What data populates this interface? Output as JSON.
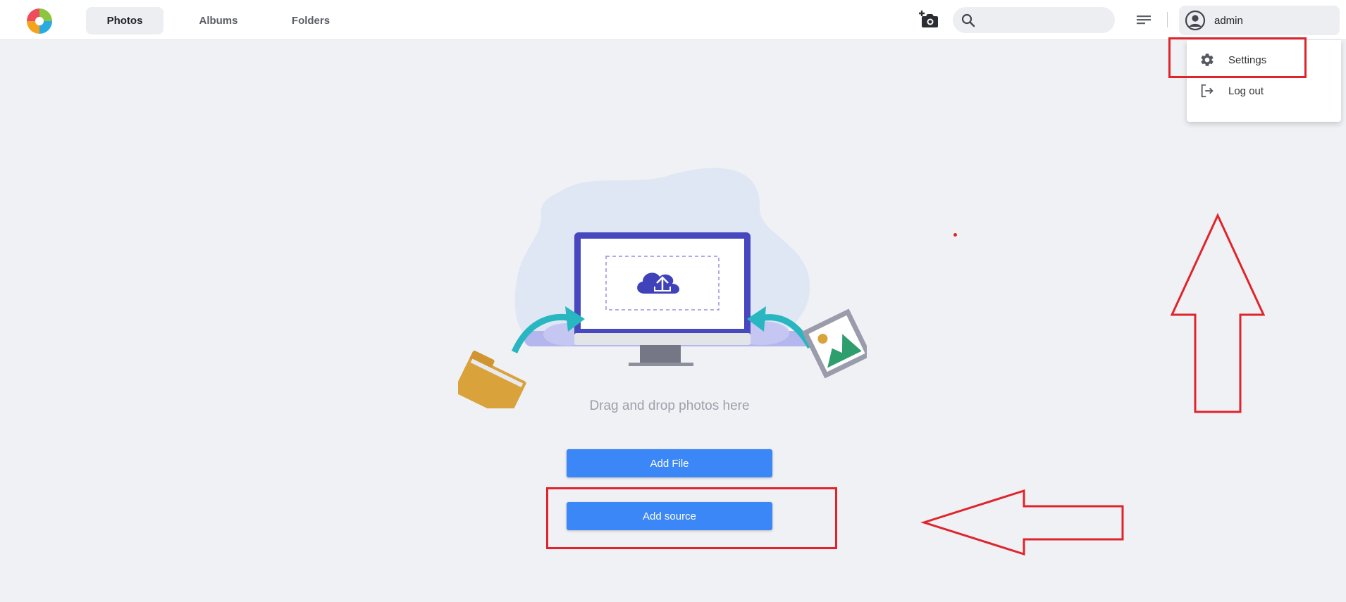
{
  "header": {
    "tabs": [
      {
        "label": "Photos",
        "active": true
      },
      {
        "label": "Albums",
        "active": false
      },
      {
        "label": "Folders",
        "active": false
      }
    ],
    "search": {
      "placeholder": "",
      "value": ""
    },
    "user": {
      "name": "admin"
    }
  },
  "user_menu": {
    "items": [
      {
        "label": "Settings",
        "icon": "gear-icon"
      },
      {
        "label": "Log out",
        "icon": "logout-icon"
      }
    ]
  },
  "main": {
    "drop_text": "Drag and drop photos here",
    "add_file_label": "Add File",
    "add_source_label": "Add source"
  },
  "colors": {
    "accent": "#3b87f7",
    "annotation": "#e0242b",
    "background": "#f0f1f5"
  }
}
